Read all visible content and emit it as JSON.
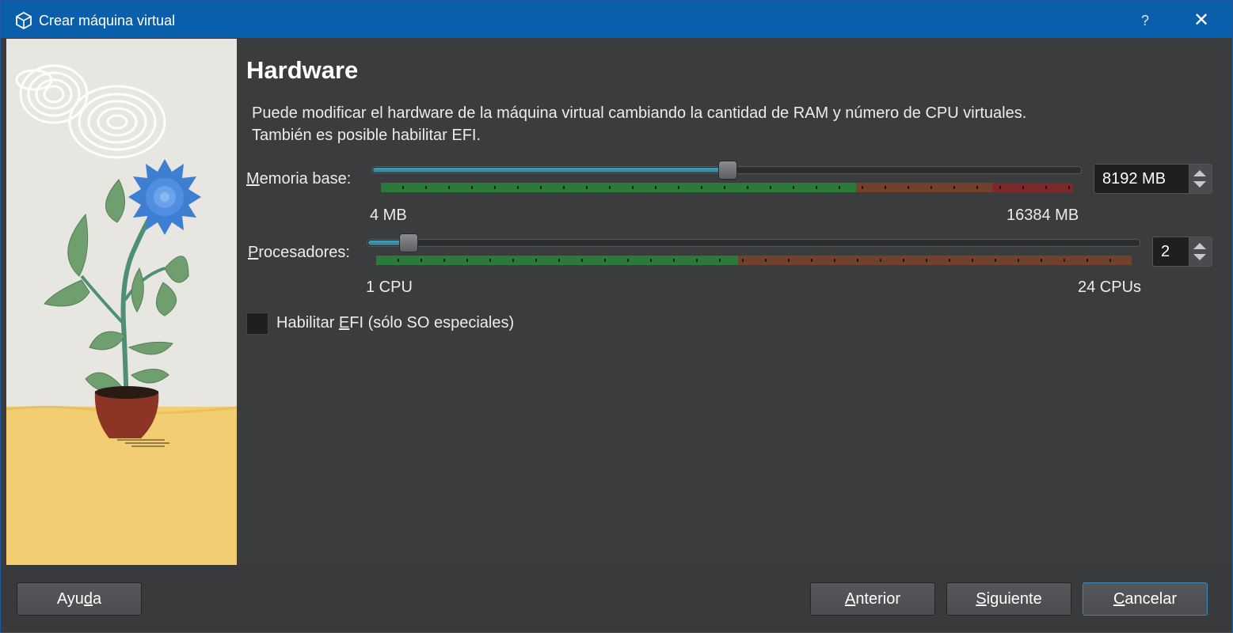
{
  "window": {
    "title": "Crear máquina virtual",
    "help_glyph": "?",
    "close_glyph": "✕"
  },
  "page": {
    "heading": "Hardware",
    "description_line1": "Puede modificar el hardware de la máquina virtual cambiando la cantidad de RAM y número de CPU virtuales.",
    "description_line2": "También es posible habilitar EFI."
  },
  "memory": {
    "label_prefix": "",
    "label_mnemonic": "M",
    "label_rest": "emoria base:",
    "value": "8192 MB",
    "min_label": "4 MB",
    "max_label": "16384 MB",
    "level_fraction": 0.5
  },
  "processors": {
    "label_prefix": "",
    "label_mnemonic": "P",
    "label_rest": "rocesadores:",
    "value": "2",
    "min_label": "1 CPU",
    "max_label": "24 CPUs",
    "level_fraction": 0.043
  },
  "efi": {
    "label_prefix": "Habilitar ",
    "label_mnemonic": "E",
    "label_rest": "FI (sólo SO especiales)",
    "checked": false
  },
  "buttons": {
    "help": {
      "pre": "Ayu",
      "mn": "d",
      "post": "a"
    },
    "back": {
      "pre": "",
      "mn": "A",
      "post": "nterior"
    },
    "next": {
      "pre": "",
      "mn": "S",
      "post": "iguiente"
    },
    "cancel": {
      "pre": "",
      "mn": "C",
      "post": "ancelar"
    }
  },
  "colors": {
    "titlebar": "#0a5fad",
    "background": "#3b3c3e",
    "slider_fill": "#2a7c94",
    "scale_green": "#2b7a3b",
    "scale_orange": "#71412e",
    "scale_red": "#7a2a2a"
  },
  "icons": [
    "virtualbox-app-icon",
    "help-icon",
    "close-icon",
    "spin-up-icon",
    "spin-down-icon"
  ]
}
